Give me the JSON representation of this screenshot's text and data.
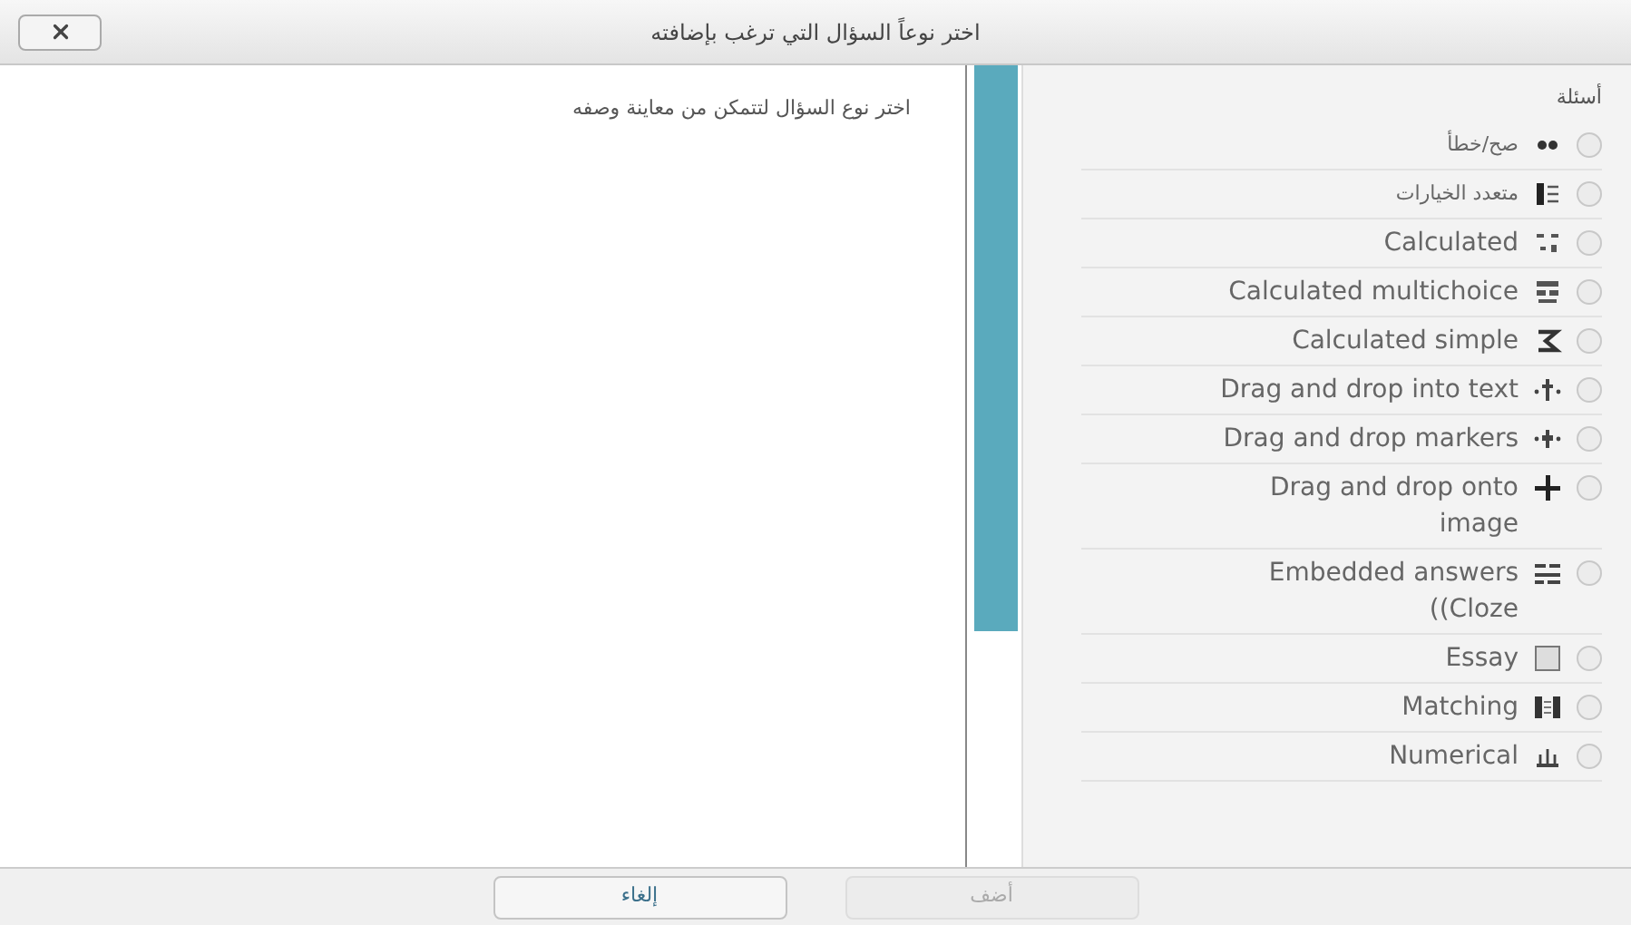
{
  "window": {
    "title": "اختر نوعاً السؤال التي ترغب بإضافته"
  },
  "description": "اختر نوع السؤال لتتمكن من معاينة وصفه",
  "list": {
    "heading": "أسئلة",
    "items": [
      {
        "label": "صح/خطأ",
        "selected": false
      },
      {
        "label": "متعدد الخيارات",
        "selected": false
      },
      {
        "label": "Calculated",
        "selected": false
      },
      {
        "label": "Calculated multichoice",
        "selected": false
      },
      {
        "label": "Calculated simple",
        "selected": false
      },
      {
        "label": "Drag and drop into text",
        "selected": false
      },
      {
        "label": "Drag and drop markers",
        "selected": false
      },
      {
        "label": "Drag and drop onto image",
        "selected": false
      },
      {
        "label": "Embedded answers ((Cloze",
        "selected": false
      },
      {
        "label": "Essay",
        "selected": false
      },
      {
        "label": "Matching",
        "selected": false
      },
      {
        "label": "Numerical",
        "selected": false
      }
    ]
  },
  "buttons": [
    {
      "label": "أضف",
      "disabled": true
    },
    {
      "label": "إلغاء",
      "disabled": false
    }
  ]
}
